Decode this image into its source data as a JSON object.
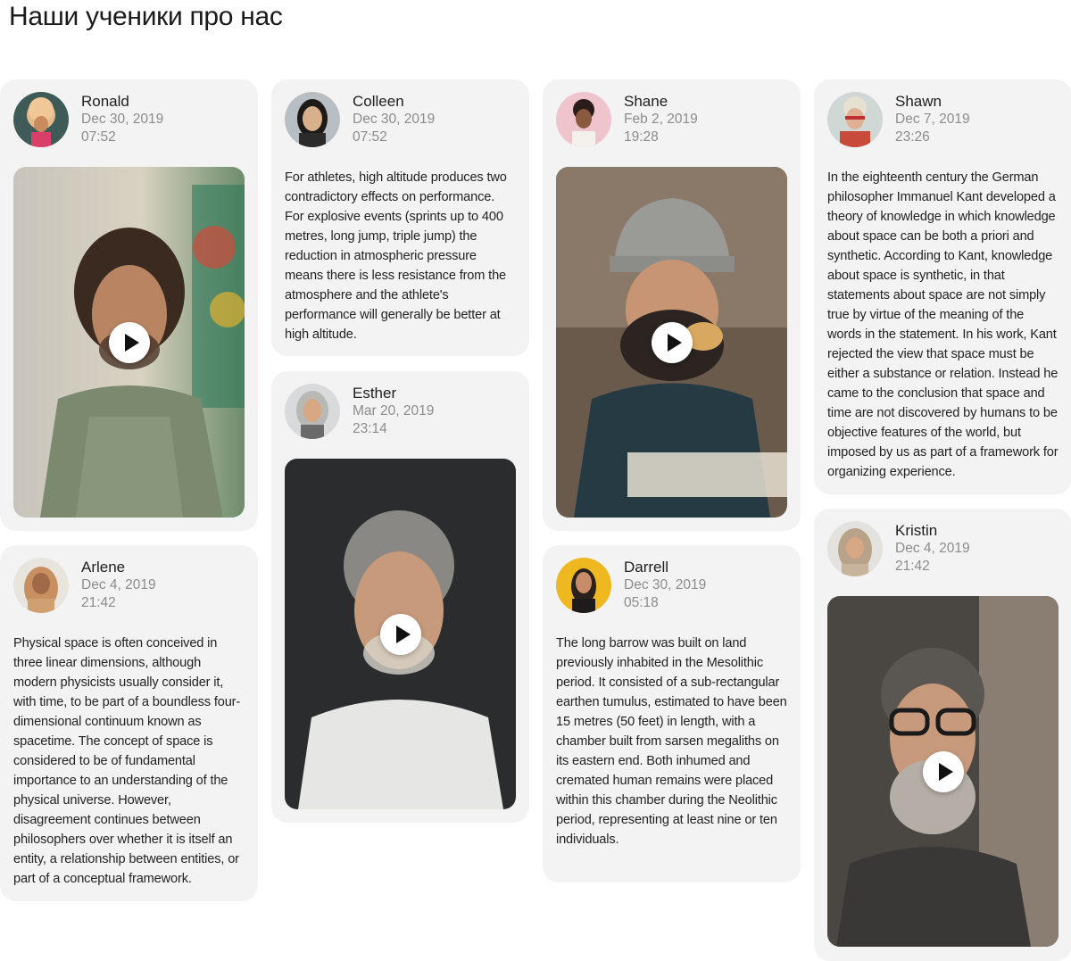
{
  "page": {
    "title": "Наши ученики про нас"
  },
  "reviews": [
    {
      "name": "Ronald",
      "date": "Dec 30, 2019",
      "time": "07:52"
    },
    {
      "name": "Colleen",
      "date": "Dec 30, 2019",
      "time": "07:52",
      "text": "For athletes, high altitude produces two contradictory effects on performance. For explosive events (sprints up to 400 metres, long jump, triple jump) the reduction in atmospheric pressure means there is less resistance from the atmosphere and the athlete's performance will generally be better at high altitude."
    },
    {
      "name": "Shane",
      "date": "Feb 2, 2019",
      "time": "19:28"
    },
    {
      "name": "Shawn",
      "date": "Dec 7, 2019",
      "time": "23:26",
      "text": "In the eighteenth century the German philosopher Immanuel Kant developed a theory of knowledge in which knowledge about space can be both a priori and synthetic. According to Kant, knowledge about space is synthetic, in that statements about space are not simply true by virtue of the meaning of the words in the statement. In his work, Kant rejected the view that space must be either a substance or relation. Instead he came to the conclusion that space and time are not discovered by humans to be objective features of the world, but imposed by us as part of a framework for organizing experience."
    },
    {
      "name": "Arlene",
      "date": "Dec 4, 2019",
      "time": "21:42",
      "text": "Physical space is often conceived in three linear dimensions, although modern physicists usually consider it, with time, to be part of a boundless four-dimensional continuum known as spacetime. The concept of space is considered to be of fundamental importance to an understanding of the physical universe. However, disagreement continues between philosophers over whether it is itself an entity, a relationship between entities, or part of a conceptual framework."
    },
    {
      "name": "Esther",
      "date": "Mar 20, 2019",
      "time": "23:14"
    },
    {
      "name": "Darrell",
      "date": "Dec 30, 2019",
      "time": "05:18",
      "text": "The long barrow was built on land previously inhabited in the Mesolithic period. It consisted of a sub-rectangular earthen tumulus, estimated to have been 15 metres (50 feet) in length, with a chamber built from sarsen megaliths on its eastern end. Both inhumed and cremated human remains were placed within this chamber during the Neolithic period, representing at least nine or ten individuals."
    },
    {
      "name": "Kristin",
      "date": "Dec 4, 2019",
      "time": "21:42"
    }
  ],
  "icons": {
    "play": "play-icon"
  },
  "colors": {
    "card_bg": "#f3f3f3",
    "meta_text": "#8c8c8c",
    "page_bg": "#ffffff"
  }
}
